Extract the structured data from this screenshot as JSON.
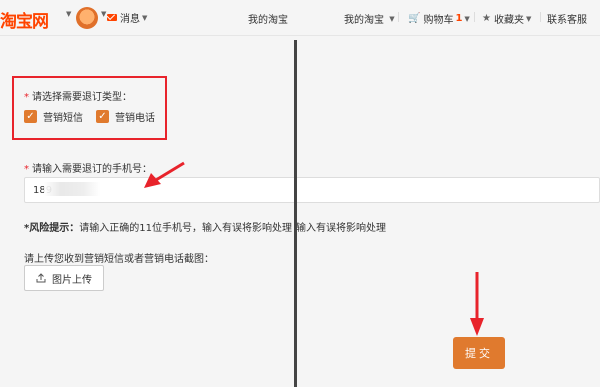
{
  "header": {
    "logo": "淘宝网",
    "messages_label": "消息",
    "nav_mytaobao_1": "我的淘宝",
    "nav_mytaobao_2": "我的淘宝",
    "cart_label": "购物车",
    "cart_count": "1",
    "favorites_label": "收藏夹",
    "help_label": "联系客服"
  },
  "form": {
    "type_label": "请选择需要退订类型：",
    "options": [
      {
        "label": "营销短信",
        "checked": true
      },
      {
        "label": "营销电话",
        "checked": true
      }
    ],
    "phone_label": "请输入需要退订的手机号：",
    "phone_value": "189",
    "risk_title": "*风险提示：",
    "risk_text": "请输入正确的11位手机号，输入有误将影响处理",
    "risk_text_overlap": "输入有误将影响处理",
    "upload_label": "请上传您收到营销短信或者营销电话截图：",
    "upload_button": "图片上传",
    "submit_label": "提交"
  },
  "colors": {
    "brand": "#ff4400",
    "accent": "#e07a2e",
    "annotation": "#e8232b"
  }
}
